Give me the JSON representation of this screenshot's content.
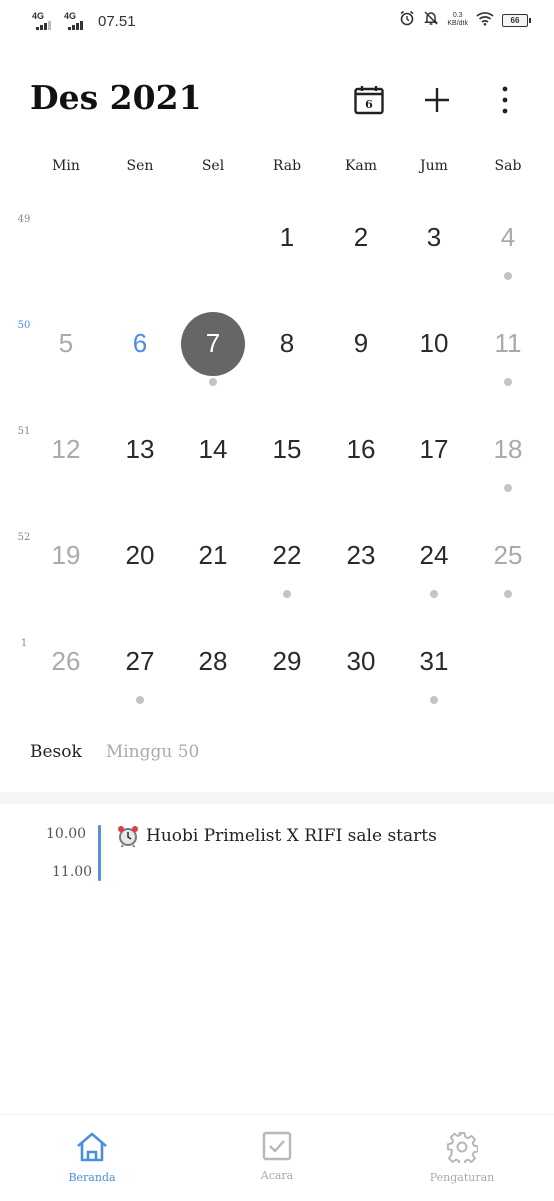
{
  "status_bar": {
    "signal1_label": "4G",
    "signal2_label": "4G",
    "time": "07.51",
    "net_speed_value": "0.3",
    "net_speed_unit": "KB/dtk",
    "battery_level": "66"
  },
  "header": {
    "month_title": "Des 2021",
    "today_icon_day": "6"
  },
  "weekdays": [
    "Min",
    "Sen",
    "Sel",
    "Rab",
    "Kam",
    "Jum",
    "Sab"
  ],
  "weeks": [
    {
      "number": "49",
      "current": false,
      "days": [
        {
          "label": ""
        },
        {
          "label": ""
        },
        {
          "label": ""
        },
        {
          "label": "1"
        },
        {
          "label": "2"
        },
        {
          "label": "3"
        },
        {
          "label": "4",
          "weekend": true,
          "event": true
        }
      ]
    },
    {
      "number": "50",
      "current": true,
      "days": [
        {
          "label": "5",
          "weekend": true
        },
        {
          "label": "6",
          "today": true
        },
        {
          "label": "7",
          "selected": true,
          "event": true
        },
        {
          "label": "8"
        },
        {
          "label": "9"
        },
        {
          "label": "10"
        },
        {
          "label": "11",
          "weekend": true,
          "event": true
        }
      ]
    },
    {
      "number": "51",
      "current": false,
      "days": [
        {
          "label": "12",
          "weekend": true
        },
        {
          "label": "13"
        },
        {
          "label": "14"
        },
        {
          "label": "15"
        },
        {
          "label": "16"
        },
        {
          "label": "17"
        },
        {
          "label": "18",
          "weekend": true,
          "event": true
        }
      ]
    },
    {
      "number": "52",
      "current": false,
      "days": [
        {
          "label": "19",
          "weekend": true
        },
        {
          "label": "20"
        },
        {
          "label": "21"
        },
        {
          "label": "22",
          "event": true
        },
        {
          "label": "23"
        },
        {
          "label": "24",
          "event": true
        },
        {
          "label": "25",
          "weekend": true,
          "event": true
        }
      ]
    },
    {
      "number": "1",
      "current": false,
      "days": [
        {
          "label": "26",
          "weekend": true
        },
        {
          "label": "27",
          "event": true
        },
        {
          "label": "28"
        },
        {
          "label": "29"
        },
        {
          "label": "30"
        },
        {
          "label": "31",
          "event": true
        },
        {
          "label": ""
        }
      ]
    }
  ],
  "tabs": {
    "tomorrow": "Besok",
    "week": "Minggu 50"
  },
  "event": {
    "start": "10.00",
    "end": "11.00",
    "icon": "alarm-clock-icon",
    "title": "Huobi Primelist X RIFI sale starts",
    "bar_color": "#5a8fe0"
  },
  "nav": {
    "home": "Beranda",
    "events": "Acara",
    "settings": "Pengaturan"
  },
  "colors": {
    "accent": "#4a90e2",
    "selected_circle": "#666666",
    "weekend_text": "#aaaaaa",
    "event_dot": "#c4c4c4"
  }
}
